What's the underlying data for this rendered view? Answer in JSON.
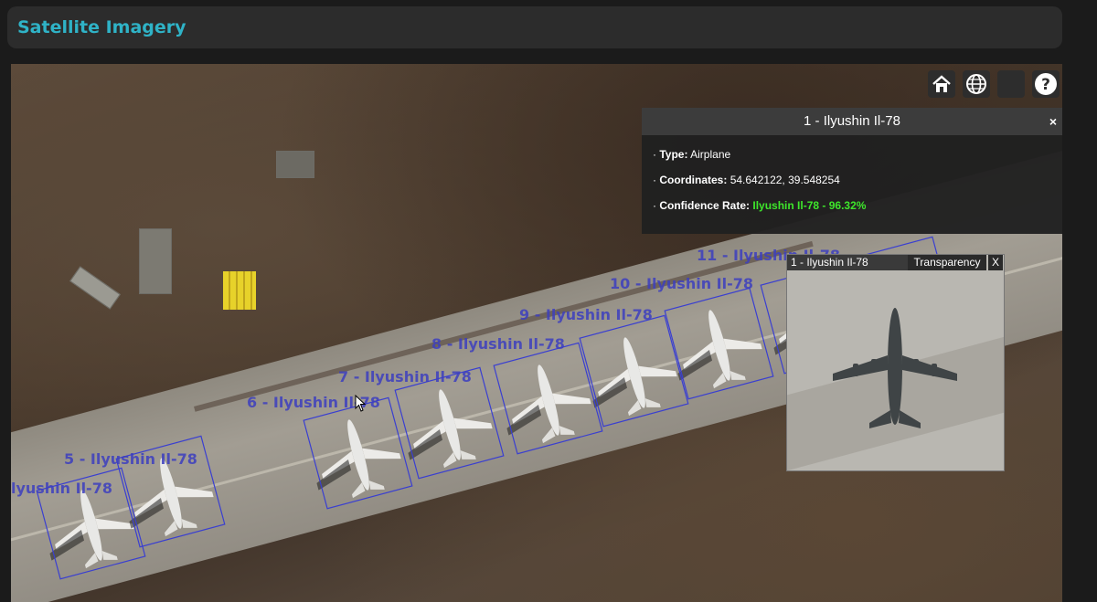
{
  "header": {
    "title": "Satellite Imagery"
  },
  "toolbar": {
    "buttons": [
      {
        "icon": "home-icon"
      },
      {
        "icon": "globe-icon"
      },
      {
        "icon": "blank"
      },
      {
        "icon": "help-icon"
      }
    ]
  },
  "detections": [
    {
      "label": "1 - Ilyushin Il-78"
    },
    {
      "label": "5 - Ilyushin Il-78"
    },
    {
      "label": "6 - Ilyushin Il-78"
    },
    {
      "label": "7 - Ilyushin Il-78"
    },
    {
      "label": "8 - Ilyushin Il-78"
    },
    {
      "label": "9 - Ilyushin Il-78"
    },
    {
      "label": "10 - Ilyushin Il-78"
    },
    {
      "label": "11 - Ilyushin Il-78"
    },
    {
      "label": "Ilyushin Il-78"
    }
  ],
  "popup": {
    "title": "1 - Ilyushin Il-78",
    "close": "×",
    "bullet": "·",
    "type_label": "Type:",
    "type_value": "Airplane",
    "coords_label": "Coordinates:",
    "coords_value": "54.642122, 39.548254",
    "confidence_label": "Confidence Rate:",
    "confidence_value": "Ilyushin Il-78 - 96.32%",
    "confidence_color": "#3ee62b"
  },
  "inset": {
    "title": "1 - Ilyushin Il-78",
    "transparency_button": "Transparency",
    "close": "X"
  },
  "colors": {
    "accent": "#2fb3c7",
    "detection_box": "#3a3fd0"
  }
}
